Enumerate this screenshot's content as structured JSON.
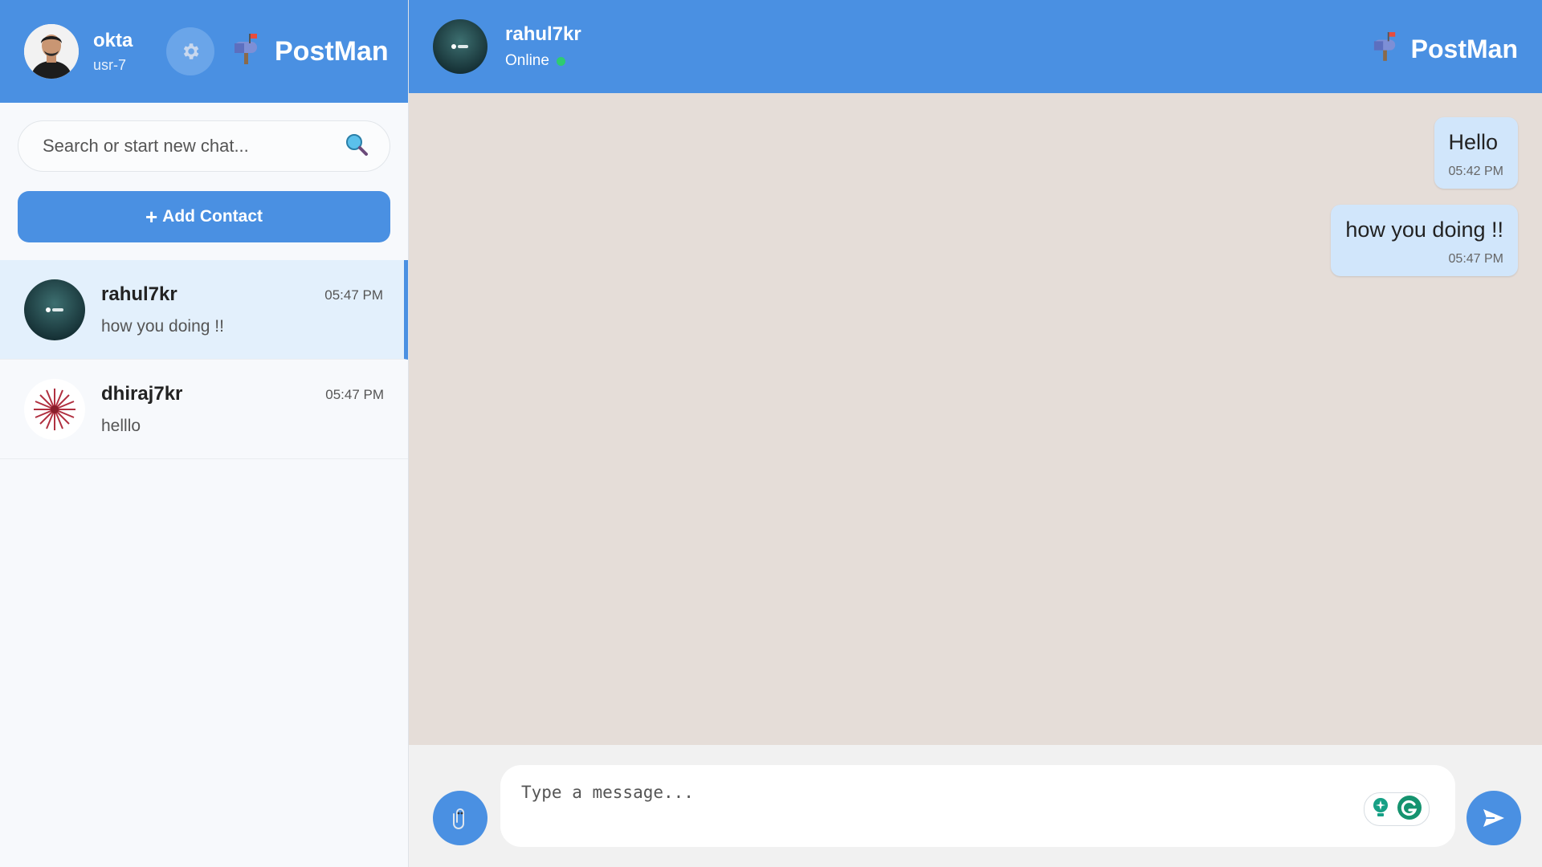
{
  "user": {
    "name": "okta",
    "id": "usr-7"
  },
  "brand": {
    "name": "PostMan"
  },
  "search": {
    "placeholder": "Search or start new chat..."
  },
  "add_contact": {
    "label": "Add Contact"
  },
  "contacts": [
    {
      "name": "rahul7kr",
      "preview": "how you doing !!",
      "time": "05:47 PM",
      "active": true
    },
    {
      "name": "dhiraj7kr",
      "preview": "helllo",
      "time": "05:47 PM",
      "active": false
    }
  ],
  "chat": {
    "name": "rahul7kr",
    "status": "Online",
    "messages": [
      {
        "text": "Hello",
        "time": "05:42 PM"
      },
      {
        "text": "how you doing !!",
        "time": "05:47 PM"
      }
    ]
  },
  "composer": {
    "placeholder": "Type a message..."
  },
  "colors": {
    "primary": "#4a90e2",
    "chat_bg": "#e5ddd8",
    "bubble": "#d1e6fb",
    "online": "#2ecc71"
  },
  "icons": {
    "settings": "gear-icon",
    "brand": "mailbox-icon",
    "search": "search-icon",
    "attach": "paperclip-icon",
    "send": "send-icon"
  }
}
